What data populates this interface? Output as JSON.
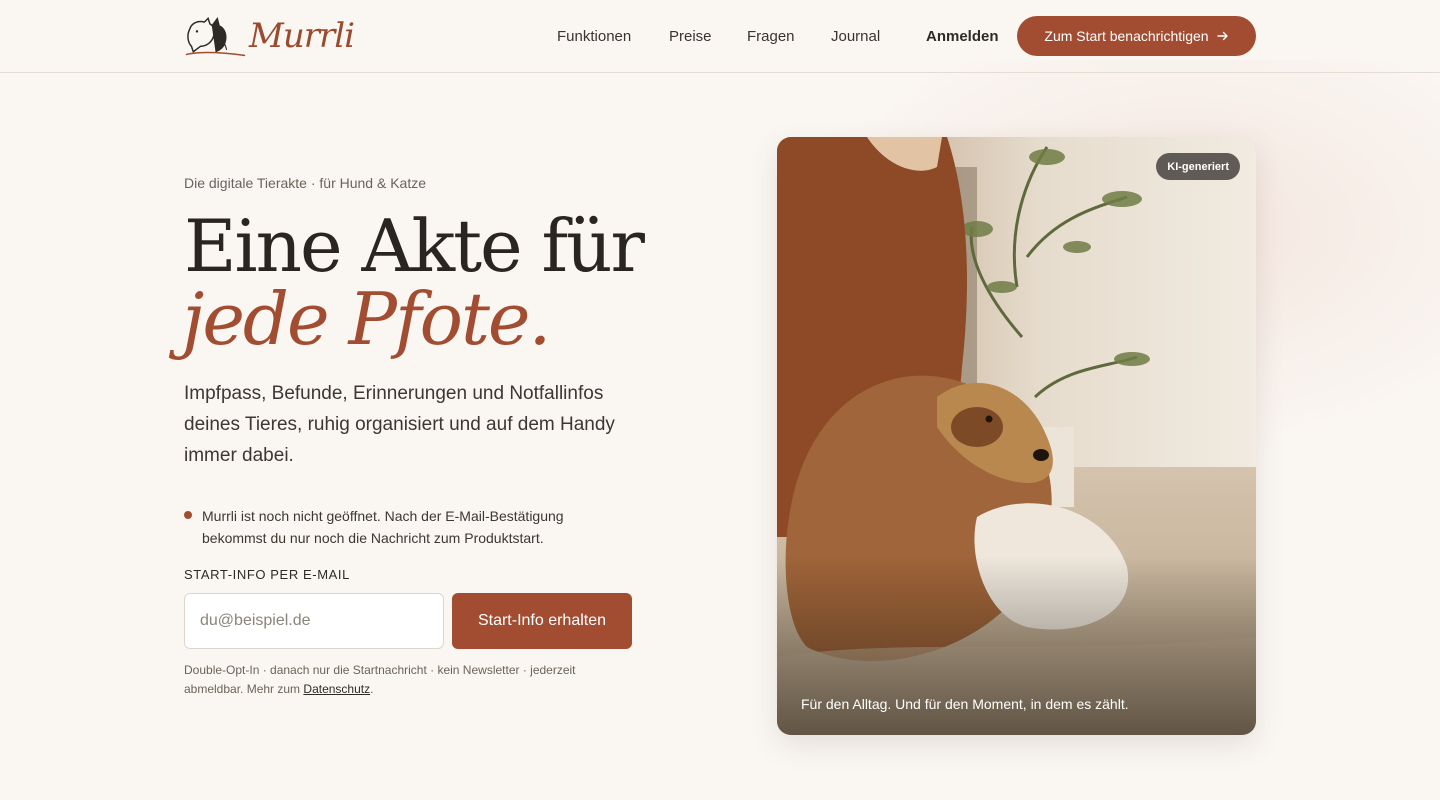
{
  "brand": {
    "name": "Murrli",
    "mark_icon": "dog-cat-logo-icon"
  },
  "nav": {
    "items": [
      {
        "label": "Funktionen"
      },
      {
        "label": "Preise"
      },
      {
        "label": "Fragen"
      },
      {
        "label": "Journal"
      }
    ],
    "login_label": "Anmelden",
    "cta_label": "Zum Start benachrichtigen",
    "cta_icon": "arrow-right-icon"
  },
  "hero": {
    "eyebrow": "Die digitale Tierakte · für Hund & Katze",
    "headline_line1": "Eine Akte für",
    "headline_line2": "jede Pfote.",
    "lead": "Impfpass, Befunde, Erinnerungen und Notfallinfos deines Tieres, ruhig organisiert und auf dem Handy immer dabei.",
    "notice": "Murrli ist noch nicht geöffnet. Nach der E-Mail-Bestätigung bekommst du nur noch die Nachricht zum Produktstart."
  },
  "form": {
    "label": "START-INFO PER E-MAIL",
    "email_placeholder": "du@beispiel.de",
    "email_value": "",
    "submit_label": "Start-Info erhalten",
    "fineprint_text": "Double-Opt-In · danach nur die Startnachricht · kein Newsletter · jederzeit abmeldbar. Mehr zum",
    "privacy_link": "Datenschutz",
    "fineprint_end": "."
  },
  "photo": {
    "badge": "KI-generiert",
    "caption": "Für den Alltag. Und für den Moment, in dem es zählt."
  },
  "colors": {
    "accent": "#a24d32",
    "background": "#faf7f3",
    "text": "#2e2a24"
  }
}
